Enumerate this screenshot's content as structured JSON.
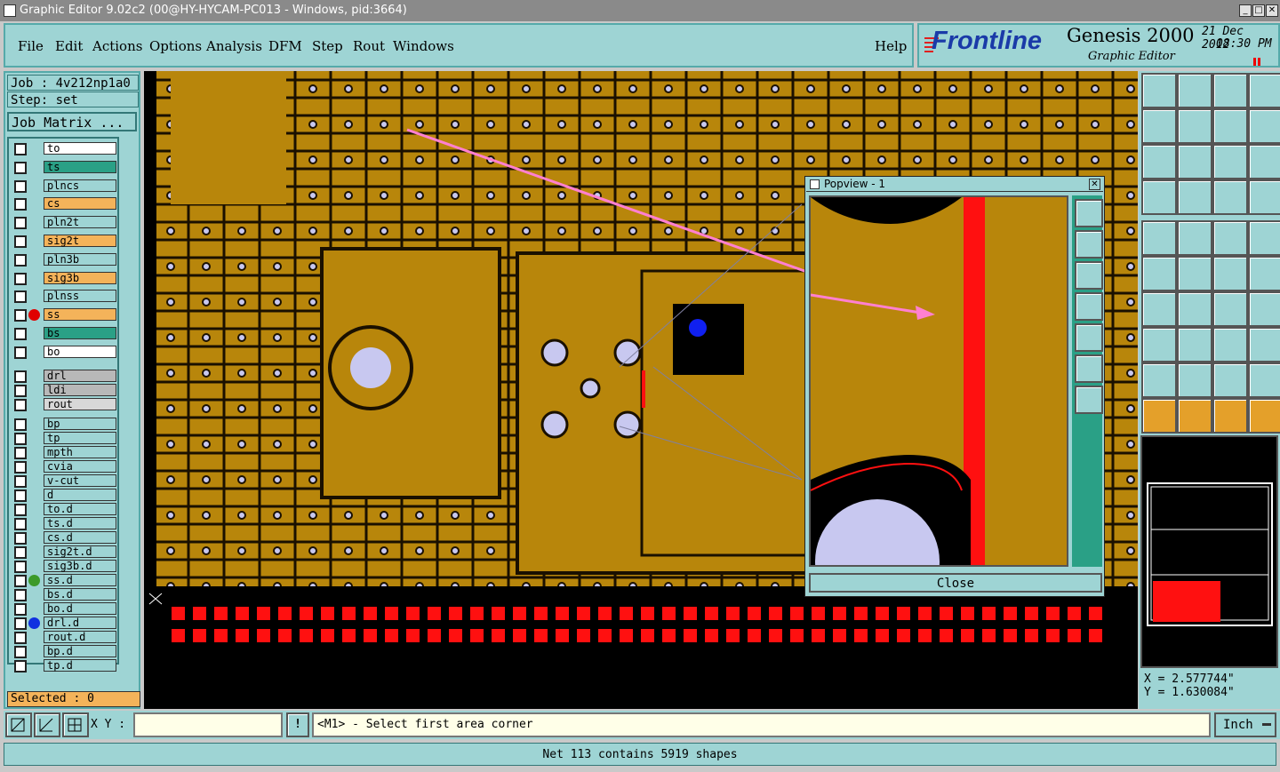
{
  "window": {
    "title": "Graphic Editor 9.02c2 (00@HY-HYCAM-PC013 - Windows, pid:3664)",
    "min_label": "_",
    "max_label": "□",
    "close_label": "✕"
  },
  "menu": {
    "items": [
      "File",
      "Edit",
      "Actions",
      "Options",
      "Analysis",
      "DFM",
      "Step",
      "Rout",
      "Windows"
    ],
    "help": "Help"
  },
  "brand": {
    "logo": "Frontline",
    "product": "Genesis 2000",
    "subtitle": "Graphic Editor",
    "date": "21 Dec 2012",
    "time": "08:30 PM"
  },
  "job": {
    "job_label": "Job : 4v212np1a0",
    "step_label": "Step: set",
    "matrix_button": "Job Matrix ..."
  },
  "layers": [
    {
      "name": "to",
      "color": "#ffffff",
      "dot": ""
    },
    {
      "name": "ts",
      "color": "#2aa086",
      "dot": ""
    },
    {
      "name": "plncs",
      "color": "#9ed4d4",
      "dot": ""
    },
    {
      "name": "cs",
      "color": "#f4b35a",
      "dot": ""
    },
    {
      "name": "pln2t",
      "color": "#9ed4d4",
      "dot": ""
    },
    {
      "name": "sig2t",
      "color": "#f4b35a",
      "dot": ""
    },
    {
      "name": "pln3b",
      "color": "#9ed4d4",
      "dot": ""
    },
    {
      "name": "sig3b",
      "color": "#f4b35a",
      "dot": ""
    },
    {
      "name": "plnss",
      "color": "#9ed4d4",
      "dot": ""
    },
    {
      "name": "ss",
      "color": "#f4b35a",
      "dot": "#e00000"
    },
    {
      "name": "bs",
      "color": "#2aa086",
      "dot": ""
    },
    {
      "name": "bo",
      "color": "#ffffff",
      "dot": ""
    },
    {
      "name": "drl",
      "color": "#b8b8b8",
      "dot": ""
    },
    {
      "name": "ldi",
      "color": "#b8b8b8",
      "dot": ""
    },
    {
      "name": "rout",
      "color": "#d8d8d8",
      "dot": ""
    },
    {
      "name": "bp",
      "color": "#9ed4d4",
      "dot": ""
    },
    {
      "name": "tp",
      "color": "#9ed4d4",
      "dot": ""
    },
    {
      "name": "mpth",
      "color": "#9ed4d4",
      "dot": ""
    },
    {
      "name": "cvia",
      "color": "#9ed4d4",
      "dot": ""
    },
    {
      "name": "v-cut",
      "color": "#9ed4d4",
      "dot": ""
    },
    {
      "name": "d",
      "color": "#9ed4d4",
      "dot": ""
    },
    {
      "name": "to.d",
      "color": "#9ed4d4",
      "dot": ""
    },
    {
      "name": "ts.d",
      "color": "#9ed4d4",
      "dot": ""
    },
    {
      "name": "cs.d",
      "color": "#9ed4d4",
      "dot": ""
    },
    {
      "name": "sig2t.d",
      "color": "#9ed4d4",
      "dot": ""
    },
    {
      "name": "sig3b.d",
      "color": "#9ed4d4",
      "dot": ""
    },
    {
      "name": "ss.d",
      "color": "#9ed4d4",
      "dot": "#3c9a2a"
    },
    {
      "name": "bs.d",
      "color": "#9ed4d4",
      "dot": ""
    },
    {
      "name": "bo.d",
      "color": "#9ed4d4",
      "dot": ""
    },
    {
      "name": "drl.d",
      "color": "#9ed4d4",
      "dot": "#1030e0"
    },
    {
      "name": "rout.d",
      "color": "#9ed4d4",
      "dot": ""
    },
    {
      "name": "bp.d",
      "color": "#9ed4d4",
      "dot": ""
    },
    {
      "name": "tp.d",
      "color": "#9ed4d4",
      "dot": ""
    }
  ],
  "selected": "Selected : 0",
  "popview": {
    "title": "Popview - 1",
    "close_button": "Close"
  },
  "coords": {
    "x": "X = 2.577744\"",
    "y": "Y = 1.630084\""
  },
  "status": {
    "xy_label": "X Y :",
    "xy_value": "",
    "prompt": "<M1> - Select first area corner",
    "unit": "Inch",
    "message": "Net 113 contains 5919 shapes"
  },
  "colors": {
    "board": "#b8860b",
    "copper_dark": "#8a6200",
    "pad": "#c8c8f0",
    "red": "#ff1010",
    "panel": "#9ed4d4"
  }
}
